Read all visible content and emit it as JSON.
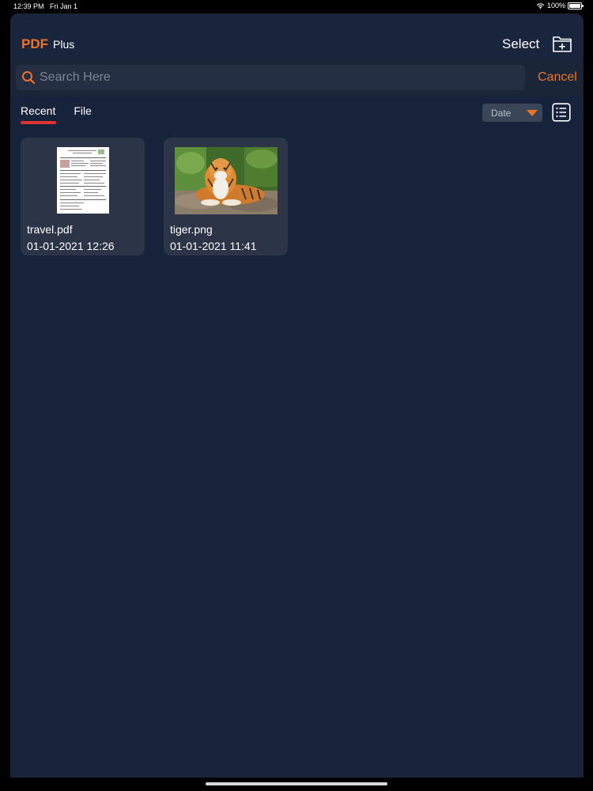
{
  "status_bar": {
    "time": "12:39 PM",
    "date": "Fri Jan 1",
    "battery": "100%"
  },
  "header": {
    "brand_primary": "PDF",
    "brand_secondary": "Plus",
    "select_label": "Select",
    "new_folder_icon": "folder-plus-icon"
  },
  "search": {
    "placeholder": "Search Here",
    "value": "",
    "cancel_label": "Cancel"
  },
  "tabs": [
    {
      "label": "Recent",
      "active": true
    },
    {
      "label": "File",
      "active": false
    }
  ],
  "sort": {
    "selected": "Date"
  },
  "files": [
    {
      "name": "travel.pdf",
      "date": "01-01-2021 12:26",
      "thumb_icon": "pdf-document-thumbnail"
    },
    {
      "name": "tiger.png",
      "date": "01-01-2021 11:41",
      "thumb_icon": "tiger-image-thumbnail"
    }
  ],
  "colors": {
    "accent": "#f07322",
    "tab_underline": "#e03232",
    "background": "#17233a",
    "card": "#2c3547"
  }
}
